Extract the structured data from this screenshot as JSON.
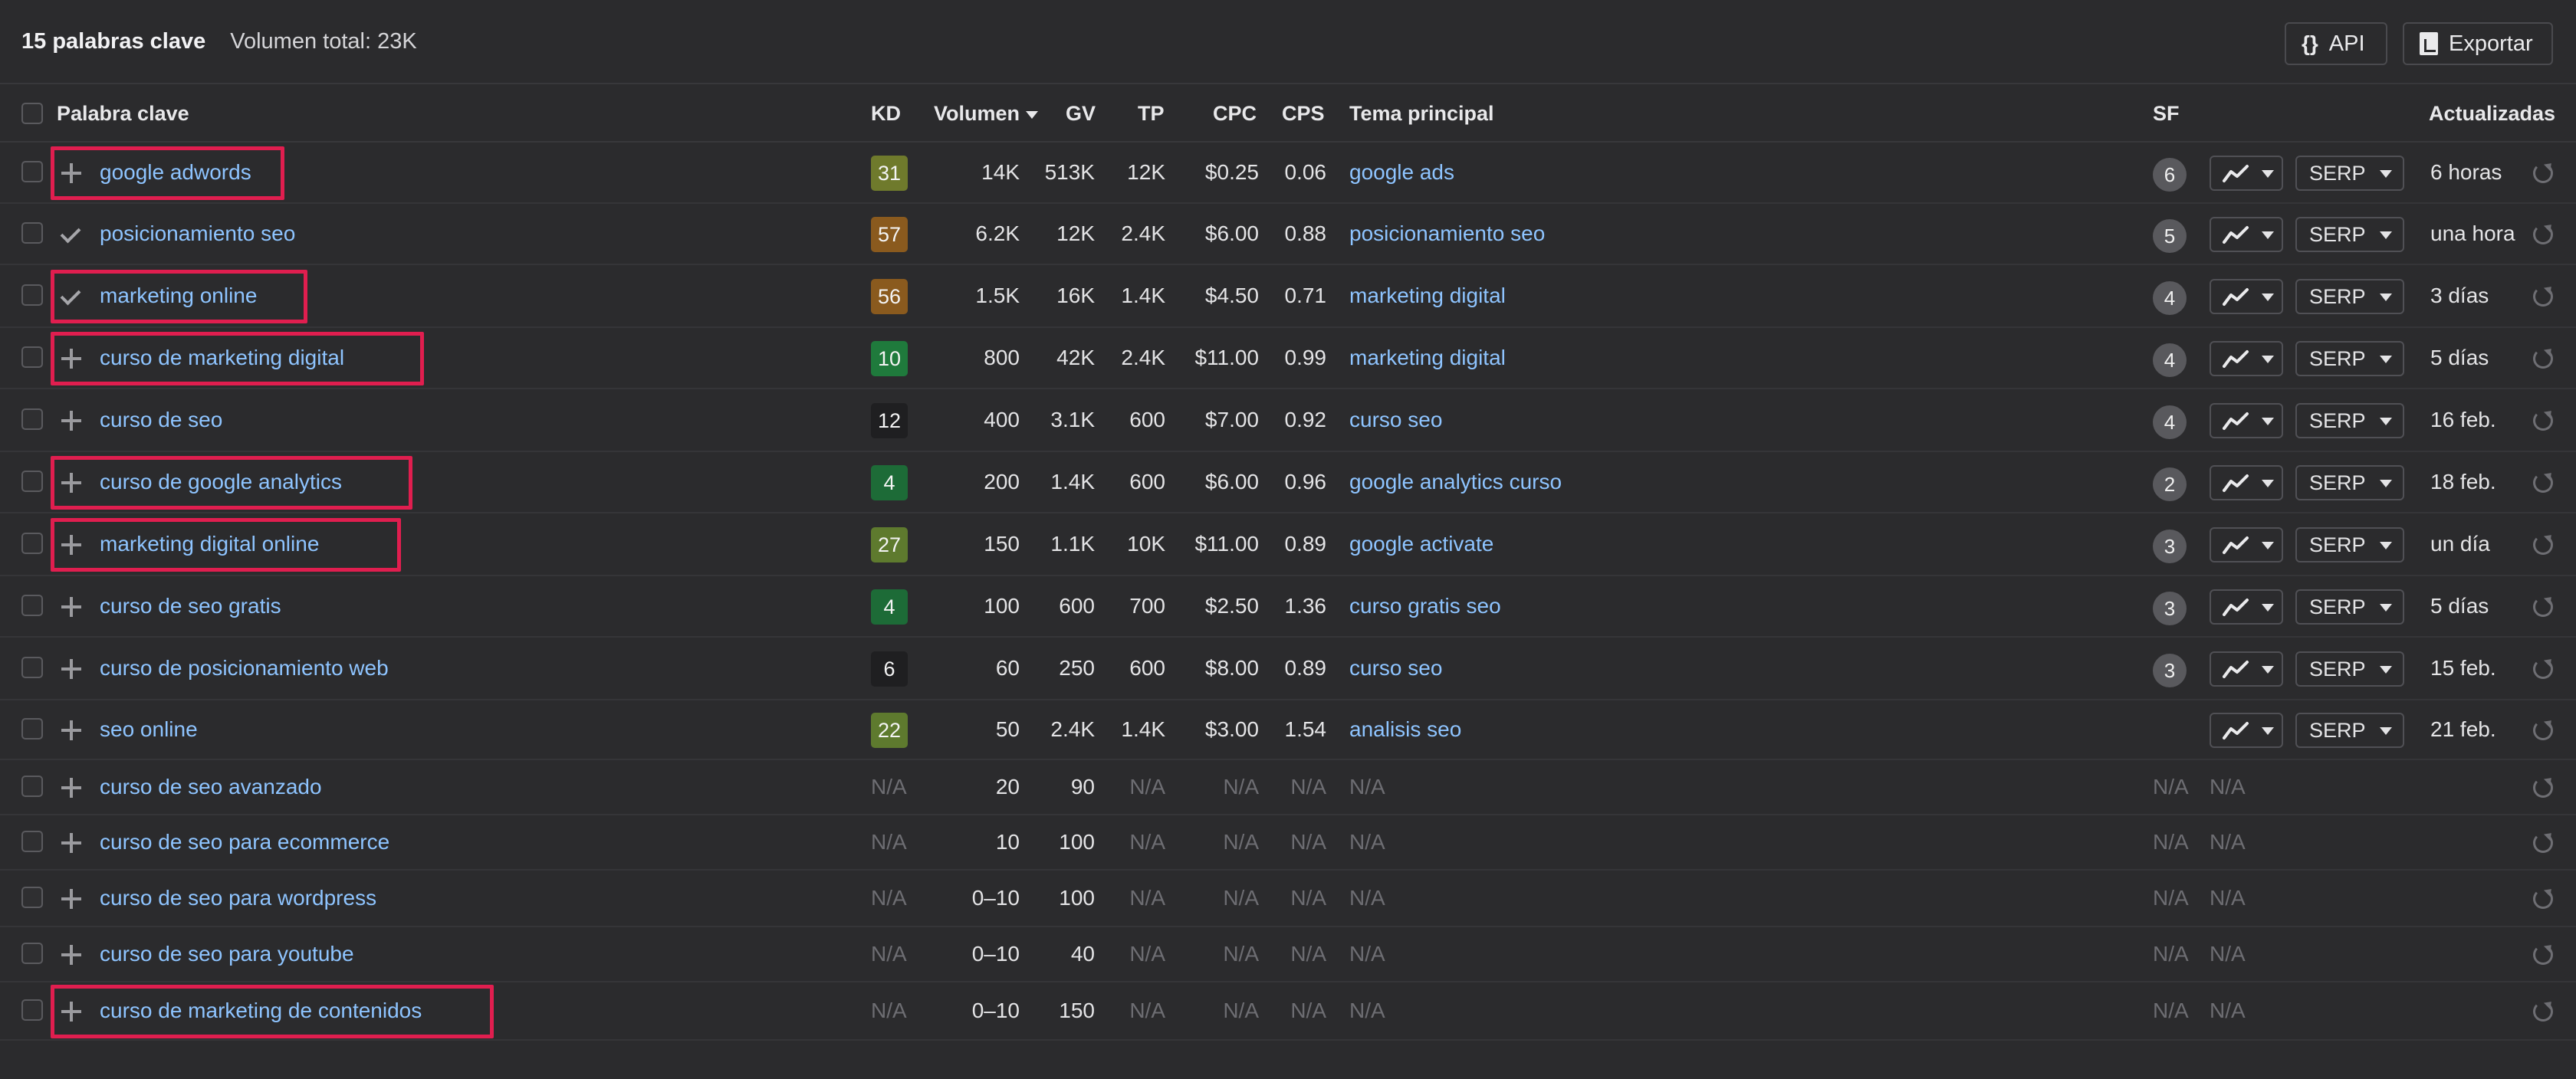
{
  "summary": {
    "keyword_count": "15 palabras clave",
    "total_volume": "Volumen total: 23K"
  },
  "toolbar": {
    "api_label": "API",
    "api_glyph": "{}",
    "export_label": "Exportar"
  },
  "columns": {
    "keyword": "Palabra clave",
    "kd": "KD",
    "volume": "Volumen",
    "gv": "GV",
    "tp": "TP",
    "cpc": "CPC",
    "cps": "CPS",
    "topic": "Tema principal",
    "sf": "SF",
    "updated": "Actualizadas"
  },
  "serp_label": "SERP",
  "colors": {
    "link": "#8ec4ff",
    "highlight": "#e01e4f",
    "kd_31": "#6f7a2c",
    "kd_57": "#8a5a1e",
    "kd_56": "#8a5a1e",
    "kd_10": "#1f7a3c",
    "kd_12": "#1f1f21",
    "kd_4": "#1d6b37",
    "kd_27": "#5e7a2e",
    "kd_6": "#1f1f21",
    "kd_22": "#5e7a2e"
  },
  "rows": [
    {
      "keyword": "google adwords",
      "mark": "plus",
      "highlighted": true,
      "kd": "31",
      "kd_color": "#6f7a2c",
      "volume": "14K",
      "gv": "513K",
      "tp": "12K",
      "cpc": "$0.25",
      "cps": "0.06",
      "topic": "google ads",
      "sf": "6",
      "has_buttons": true,
      "updated": "6 horas"
    },
    {
      "keyword": "posicionamiento seo",
      "mark": "check",
      "highlighted": false,
      "kd": "57",
      "kd_color": "#8a5a1e",
      "volume": "6.2K",
      "gv": "12K",
      "tp": "2.4K",
      "cpc": "$6.00",
      "cps": "0.88",
      "topic": "posicionamiento seo",
      "sf": "5",
      "has_buttons": true,
      "updated": "una hora"
    },
    {
      "keyword": "marketing online",
      "mark": "check",
      "highlighted": true,
      "kd": "56",
      "kd_color": "#8a5a1e",
      "volume": "1.5K",
      "gv": "16K",
      "tp": "1.4K",
      "cpc": "$4.50",
      "cps": "0.71",
      "topic": "marketing digital",
      "sf": "4",
      "has_buttons": true,
      "updated": "3 días"
    },
    {
      "keyword": "curso de marketing digital",
      "mark": "plus",
      "highlighted": true,
      "kd": "10",
      "kd_color": "#1f7a3c",
      "volume": "800",
      "gv": "42K",
      "tp": "2.4K",
      "cpc": "$11.00",
      "cps": "0.99",
      "topic": "marketing digital",
      "sf": "4",
      "has_buttons": true,
      "updated": "5 días"
    },
    {
      "keyword": "curso de seo",
      "mark": "plus",
      "highlighted": false,
      "kd": "12",
      "kd_color": "#1f1f21",
      "volume": "400",
      "gv": "3.1K",
      "tp": "600",
      "cpc": "$7.00",
      "cps": "0.92",
      "topic": "curso seo",
      "sf": "4",
      "has_buttons": true,
      "updated": "16 feb."
    },
    {
      "keyword": "curso de google analytics",
      "mark": "plus",
      "highlighted": true,
      "kd": "4",
      "kd_color": "#1d6b37",
      "volume": "200",
      "gv": "1.4K",
      "tp": "600",
      "cpc": "$6.00",
      "cps": "0.96",
      "topic": "google analytics curso",
      "sf": "2",
      "has_buttons": true,
      "updated": "18 feb."
    },
    {
      "keyword": "marketing digital online",
      "mark": "plus",
      "highlighted": true,
      "kd": "27",
      "kd_color": "#5e7a2e",
      "volume": "150",
      "gv": "1.1K",
      "tp": "10K",
      "cpc": "$11.00",
      "cps": "0.89",
      "topic": "google activate",
      "sf": "3",
      "has_buttons": true,
      "updated": "un día"
    },
    {
      "keyword": "curso de seo gratis",
      "mark": "plus",
      "highlighted": false,
      "kd": "4",
      "kd_color": "#1d6b37",
      "volume": "100",
      "gv": "600",
      "tp": "700",
      "cpc": "$2.50",
      "cps": "1.36",
      "topic": "curso gratis seo",
      "sf": "3",
      "has_buttons": true,
      "updated": "5 días"
    },
    {
      "keyword": "curso de posicionamiento web",
      "mark": "plus",
      "highlighted": false,
      "kd": "6",
      "kd_color": "#1f1f21",
      "volume": "60",
      "gv": "250",
      "tp": "600",
      "cpc": "$8.00",
      "cps": "0.89",
      "topic": "curso seo",
      "sf": "3",
      "has_buttons": true,
      "updated": "15 feb."
    },
    {
      "keyword": "seo online",
      "mark": "plus",
      "highlighted": false,
      "kd": "22",
      "kd_color": "#5e7a2e",
      "volume": "50",
      "gv": "2.4K",
      "tp": "1.4K",
      "cpc": "$3.00",
      "cps": "1.54",
      "topic": "analisis seo",
      "sf": "",
      "has_buttons": true,
      "updated": "21 feb."
    },
    {
      "keyword": "curso de seo avanzado",
      "mark": "plus",
      "highlighted": false,
      "kd": "N/A",
      "kd_color": "",
      "volume": "20",
      "gv": "90",
      "tp": "N/A",
      "cpc": "N/A",
      "cps": "N/A",
      "topic": "N/A",
      "sf": "N/A",
      "sf2": "N/A",
      "has_buttons": false,
      "updated": ""
    },
    {
      "keyword": "curso de seo para ecommerce",
      "mark": "plus",
      "highlighted": false,
      "kd": "N/A",
      "kd_color": "",
      "volume": "10",
      "gv": "100",
      "tp": "N/A",
      "cpc": "N/A",
      "cps": "N/A",
      "topic": "N/A",
      "sf": "N/A",
      "sf2": "N/A",
      "has_buttons": false,
      "updated": ""
    },
    {
      "keyword": "curso de seo para wordpress",
      "mark": "plus",
      "highlighted": false,
      "kd": "N/A",
      "kd_color": "",
      "volume": "0–10",
      "gv": "100",
      "tp": "N/A",
      "cpc": "N/A",
      "cps": "N/A",
      "topic": "N/A",
      "sf": "N/A",
      "sf2": "N/A",
      "has_buttons": false,
      "updated": ""
    },
    {
      "keyword": "curso de seo para youtube",
      "mark": "plus",
      "highlighted": false,
      "kd": "N/A",
      "kd_color": "",
      "volume": "0–10",
      "gv": "40",
      "tp": "N/A",
      "cpc": "N/A",
      "cps": "N/A",
      "topic": "N/A",
      "sf": "N/A",
      "sf2": "N/A",
      "has_buttons": false,
      "updated": ""
    },
    {
      "keyword": "curso de marketing de contenidos",
      "mark": "plus",
      "highlighted": true,
      "kd": "N/A",
      "kd_color": "",
      "volume": "0–10",
      "gv": "150",
      "tp": "N/A",
      "cpc": "N/A",
      "cps": "N/A",
      "topic": "N/A",
      "sf": "N/A",
      "sf2": "N/A",
      "has_buttons": false,
      "updated": ""
    }
  ]
}
